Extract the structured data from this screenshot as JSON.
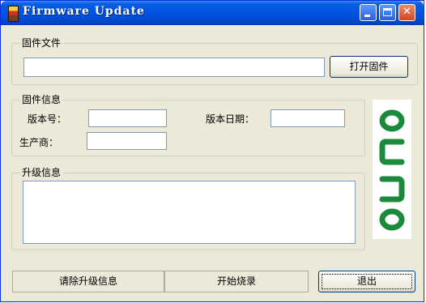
{
  "window": {
    "title": "Firmware Update"
  },
  "firmware_file": {
    "group_label": "固件文件",
    "path_value": "",
    "open_button": "打开固件"
  },
  "firmware_info": {
    "group_label": "固件信息",
    "version_label": "版本号：",
    "version_value": "",
    "date_label": "版本日期：",
    "date_value": "",
    "vendor_label": "生产商：",
    "vendor_value": ""
  },
  "upgrade_info": {
    "group_label": "升级信息",
    "log_value": ""
  },
  "buttons": {
    "clear": "请除升级信息",
    "start": "开始烧录",
    "exit": "退出"
  },
  "logo": {
    "icon": "ongo-logo-icon",
    "color": "#1a8a3a"
  },
  "colors": {
    "title_bar": "#0054e3",
    "window_bg": "#ece9d8",
    "close_button": "#d5451e"
  }
}
